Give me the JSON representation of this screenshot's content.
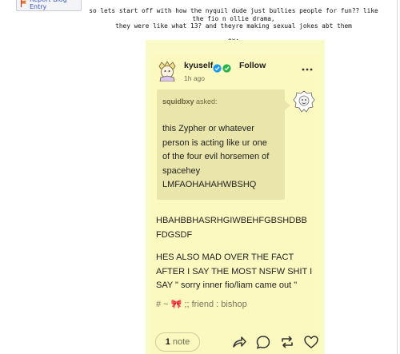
{
  "report": {
    "label": "Report Blog Entry"
  },
  "caption": {
    "line1": "so lets start off with how the nyquil dude just bullies people for fun?? like the fio n ollie drama,",
    "line2": "they were like what 13? and theyre making sexual jokes abt them",
    "line3": "ex;"
  },
  "post": {
    "username": "kyuself",
    "follow": "Follow",
    "time": "1h ago",
    "ask": {
      "asker": "squidbxy",
      "asked": "asked:",
      "lines": [
        "this Zypher or whatever",
        "person is acting like ur one",
        "of the four evil horsemen of",
        "spacehey",
        "LMFAOHAHAHWBSHQ"
      ]
    },
    "body": {
      "p1": [
        "HBAHBBHASRHGIWBEHFGBSHDBB",
        "FDGSDF"
      ],
      "p2": [
        "HES ALSO MAD OVER THE FACT",
        "AFTER I SAY THE MOST NSFW SHIT I",
        "SAY \" sorry inner fio/liam came out \""
      ]
    },
    "tags": {
      "prefix": "# ~ ",
      "emoji": "🎀",
      "rest": " ;; friend : bishop"
    },
    "notes": {
      "count": "1",
      "label": "note"
    }
  },
  "colors": {
    "post_bg": "#fbf9c0",
    "ask_bg": "#eae6ab",
    "link_blue": "#3a56c5",
    "verified_blue": "#1d9bf0",
    "verified_green": "#2ab44e"
  },
  "icons": [
    "flag-icon",
    "verified-blue-icon",
    "verified-green-icon",
    "more-icon",
    "share-icon",
    "reply-icon",
    "reblog-icon",
    "like-icon"
  ]
}
